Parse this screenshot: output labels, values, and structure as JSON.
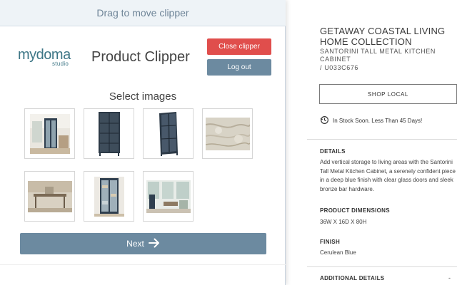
{
  "product_page": {
    "collection": "GETAWAY COASTAL LIVING HOME COLLECTION",
    "product_name": "SANTORINI TALL METAL KITCHEN CABINET",
    "sku": "/ U033C676",
    "shop_local_label": "SHOP LOCAL",
    "stock_status": "In Stock Soon. Less Than 45 Days!",
    "details_title": "DETAILS",
    "details_text": "Add vertical storage to living areas with the Santorini Tall Metal Kitchen Cabinet, a serenely confident piece in a deep blue finish with clear glass doors and sleek bronze bar hardware.",
    "dimensions_title": "PRODUCT DIMENSIONS",
    "dimensions_value": "36W X 16D X 80H",
    "finish_title": "FINISH",
    "finish_value": "Cerulean Blue",
    "additional_title": "ADDITIONAL DETAILS",
    "additional_toggle": "-"
  },
  "clipper": {
    "drag_bar_label": "Drag to move clipper",
    "logo_brand": "mydoma",
    "logo_sub": "studio",
    "title": "Product Clipper",
    "close_label": "Close clipper",
    "logout_label": "Log out",
    "select_label": "Select images",
    "next_label": "Next",
    "thumbnails": [
      {
        "id": "thumb-1",
        "subject": "cabinet-in-living-room"
      },
      {
        "id": "thumb-2",
        "subject": "cabinet-front"
      },
      {
        "id": "thumb-3",
        "subject": "cabinet-angle"
      },
      {
        "id": "thumb-4",
        "subject": "marble-texture"
      },
      {
        "id": "thumb-5",
        "subject": "console-table-room"
      },
      {
        "id": "thumb-6",
        "subject": "cabinet-styled"
      },
      {
        "id": "thumb-7",
        "subject": "sunroom-interior"
      }
    ]
  },
  "colors": {
    "close_button": "#e04e4c",
    "secondary_button": "#6c8aa0",
    "brand_teal": "#3d7686",
    "drag_bar_bg": "#eef3f7"
  },
  "icons": {
    "stock": "clock-refresh-icon",
    "next": "arrow-right-icon"
  }
}
